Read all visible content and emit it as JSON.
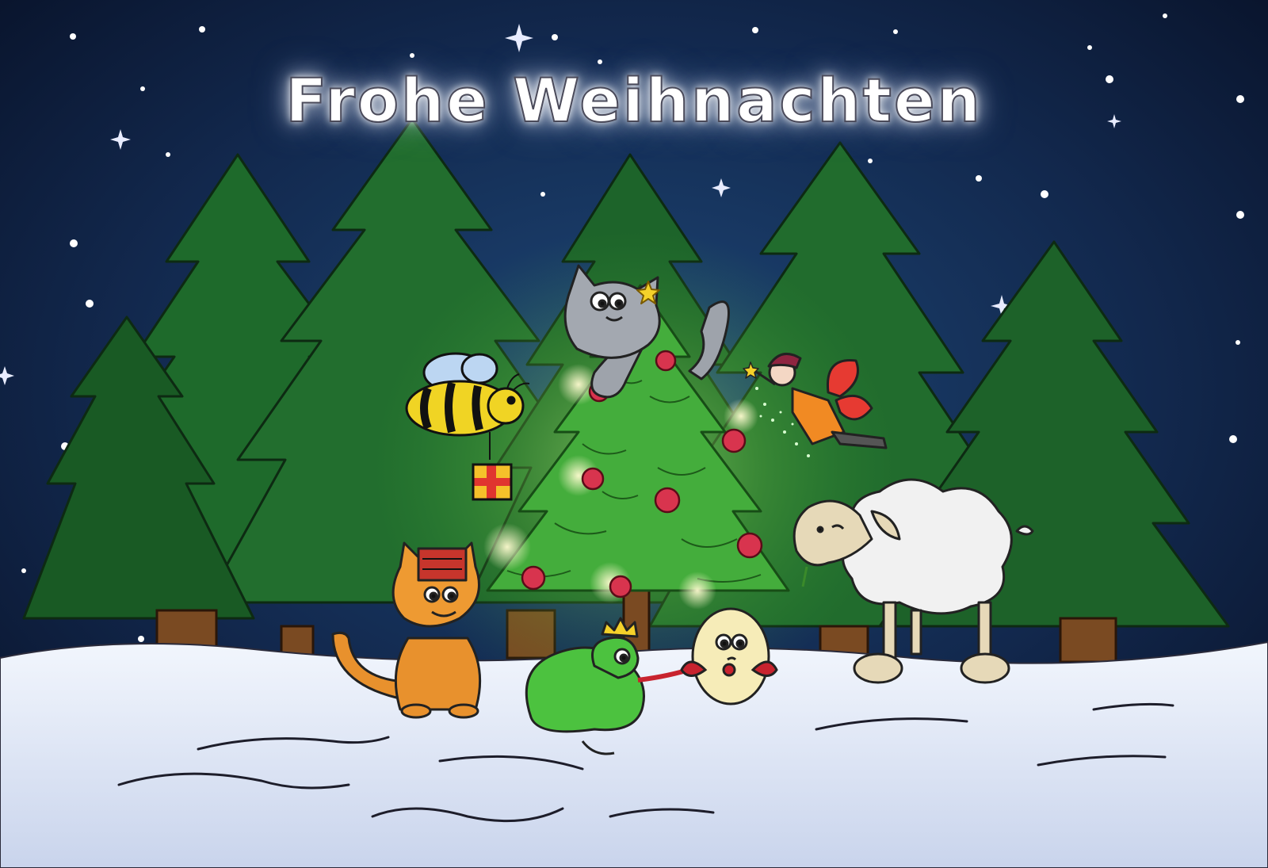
{
  "card": {
    "greeting": "Frohe Weihnachten"
  },
  "colors": {
    "sky_top": "#0a1430",
    "sky_mid": "#14305a",
    "pine": "#1f6b2c",
    "pine_dark": "#123f1a",
    "christmas_tree": "#3fa73a",
    "bauble": "#d8344e",
    "snow": "#e6edf8",
    "snow_shadow": "#b7c3df",
    "trunk": "#7a4a22"
  },
  "characters": [
    "cat",
    "bee",
    "gift",
    "fairy",
    "sheep",
    "orange-cat",
    "frog-king",
    "egg"
  ]
}
